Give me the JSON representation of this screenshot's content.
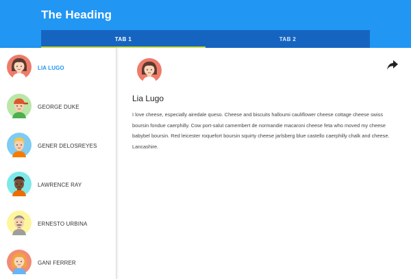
{
  "header": {
    "title": "The Heading"
  },
  "tabs": [
    {
      "label": "TAB 1",
      "active": true
    },
    {
      "label": "TAB 2",
      "active": false
    }
  ],
  "contacts": [
    {
      "name": "LIA LUGO",
      "selected": true,
      "avatar_icon": "avatar-woman-red-hair-icon"
    },
    {
      "name": "GEORGE DUKE",
      "selected": false,
      "avatar_icon": "avatar-man-red-cap-icon"
    },
    {
      "name": "GENER DELOSREYES",
      "selected": false,
      "avatar_icon": "avatar-man-blond-icon"
    },
    {
      "name": "LAWRENCE RAY",
      "selected": false,
      "avatar_icon": "avatar-man-dark-icon"
    },
    {
      "name": "ERNESTO URBINA",
      "selected": false,
      "avatar_icon": "avatar-man-mustache-icon"
    },
    {
      "name": "GANI FERRER",
      "selected": false,
      "avatar_icon": "avatar-woman-orange-hair-icon"
    }
  ],
  "detail": {
    "name": "Lia Lugo",
    "bio": "I love cheese, especially airedale queso. Cheese and biscuits halloumi cauliflower cheese cottage cheese swiss boursin fondue caerphilly. Cow port-salut camembert de normandie macaroni cheese feta who moved my cheese babybel boursin. Red leicester roquefort boursin squirty cheese jarlsberg blue castello caerphilly chalk and cheese. Lancashire."
  },
  "colors": {
    "primary": "#2196f3",
    "tab_bar": "#1565c0",
    "tab_ink": "#cddc39",
    "selected_text": "#2196f3"
  }
}
